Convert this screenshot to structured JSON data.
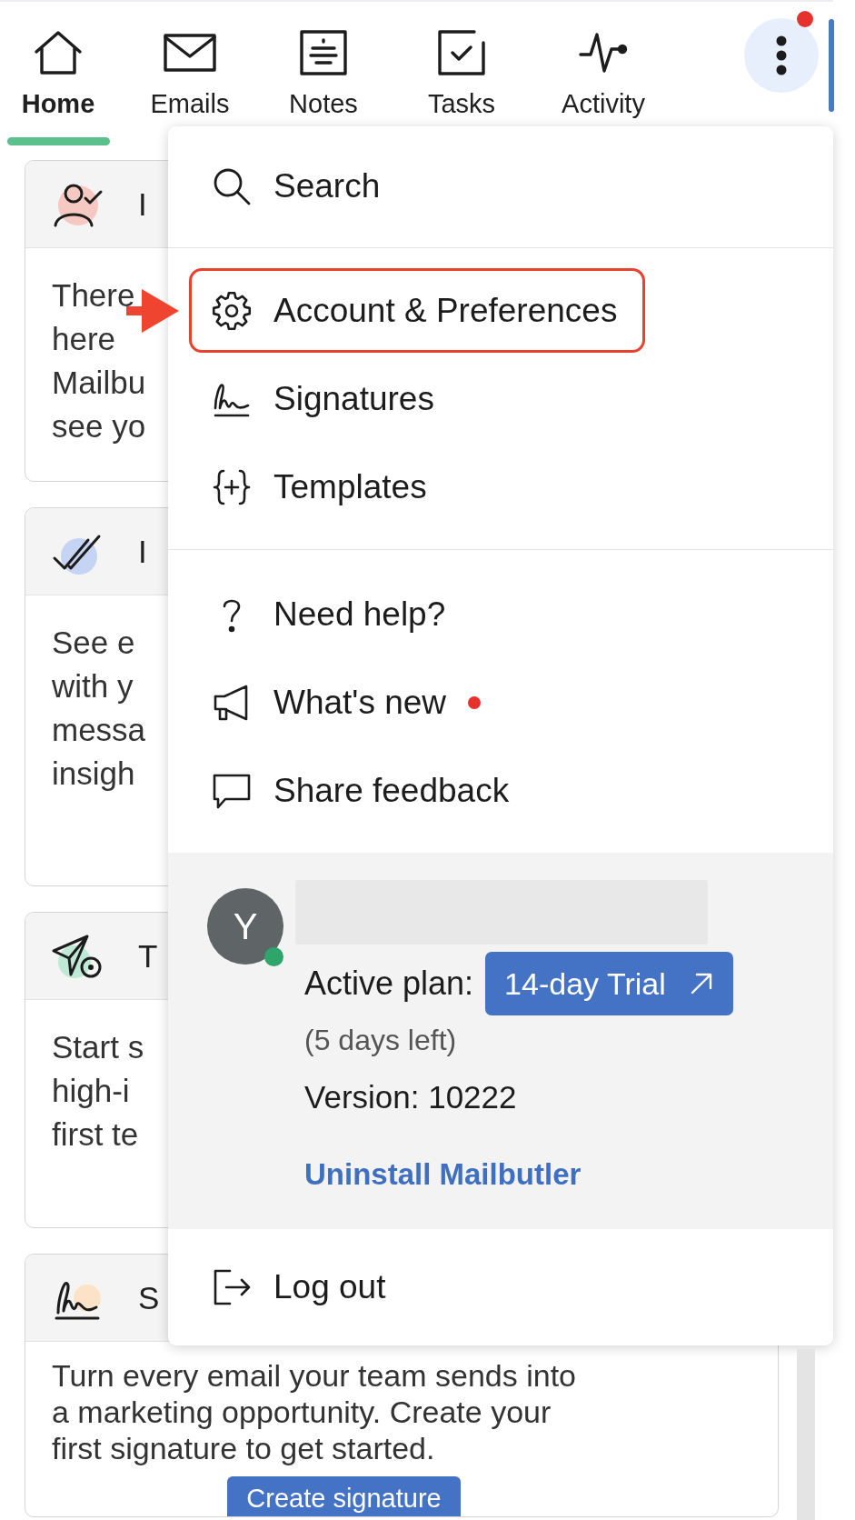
{
  "nav": {
    "tabs": [
      {
        "label": "Home",
        "selected": true
      },
      {
        "label": "Emails",
        "selected": false
      },
      {
        "label": "Notes",
        "selected": false
      },
      {
        "label": "Tasks",
        "selected": false
      },
      {
        "label": "Activity",
        "selected": false
      }
    ],
    "more_button": {
      "expanded": true,
      "has_notification": true
    }
  },
  "cards": [
    {
      "title": "I",
      "body_lines": [
        "There",
        "here",
        "Mailbu",
        "see yo"
      ]
    },
    {
      "title": "I",
      "body_lines": [
        "See e",
        "with y",
        "messa",
        "insigh"
      ]
    },
    {
      "title": "T",
      "body_lines": [
        "Start s",
        "high-i",
        "first te"
      ]
    },
    {
      "title": "S",
      "body": "Turn every email your team sends into a marketing opportunity. Create your first signature to get started.",
      "button": "Create signature"
    }
  ],
  "menu": {
    "sections": [
      {
        "items": [
          {
            "label": "Search",
            "highlighted": false,
            "has_update": false
          }
        ]
      },
      {
        "items": [
          {
            "label": "Account & Preferences",
            "highlighted": true,
            "has_update": false
          },
          {
            "label": "Signatures",
            "highlighted": false,
            "has_update": false
          },
          {
            "label": "Templates",
            "highlighted": false,
            "has_update": false
          }
        ]
      },
      {
        "items": [
          {
            "label": "Need help?",
            "highlighted": false,
            "has_update": false
          },
          {
            "label": "What's new",
            "highlighted": false,
            "has_update": true
          },
          {
            "label": "Share feedback",
            "highlighted": false,
            "has_update": false
          }
        ]
      }
    ],
    "account": {
      "avatar_letter": "Y",
      "online": true,
      "name_redacted": true,
      "plan_label": "Active plan:",
      "plan_button": "14-day Trial",
      "days_left": "(5 days left)",
      "version": "Version: 10222",
      "uninstall_link": "Uninstall Mailbutler"
    },
    "footer_items": [
      {
        "label": "Log out",
        "highlighted": false,
        "has_update": false
      }
    ]
  }
}
